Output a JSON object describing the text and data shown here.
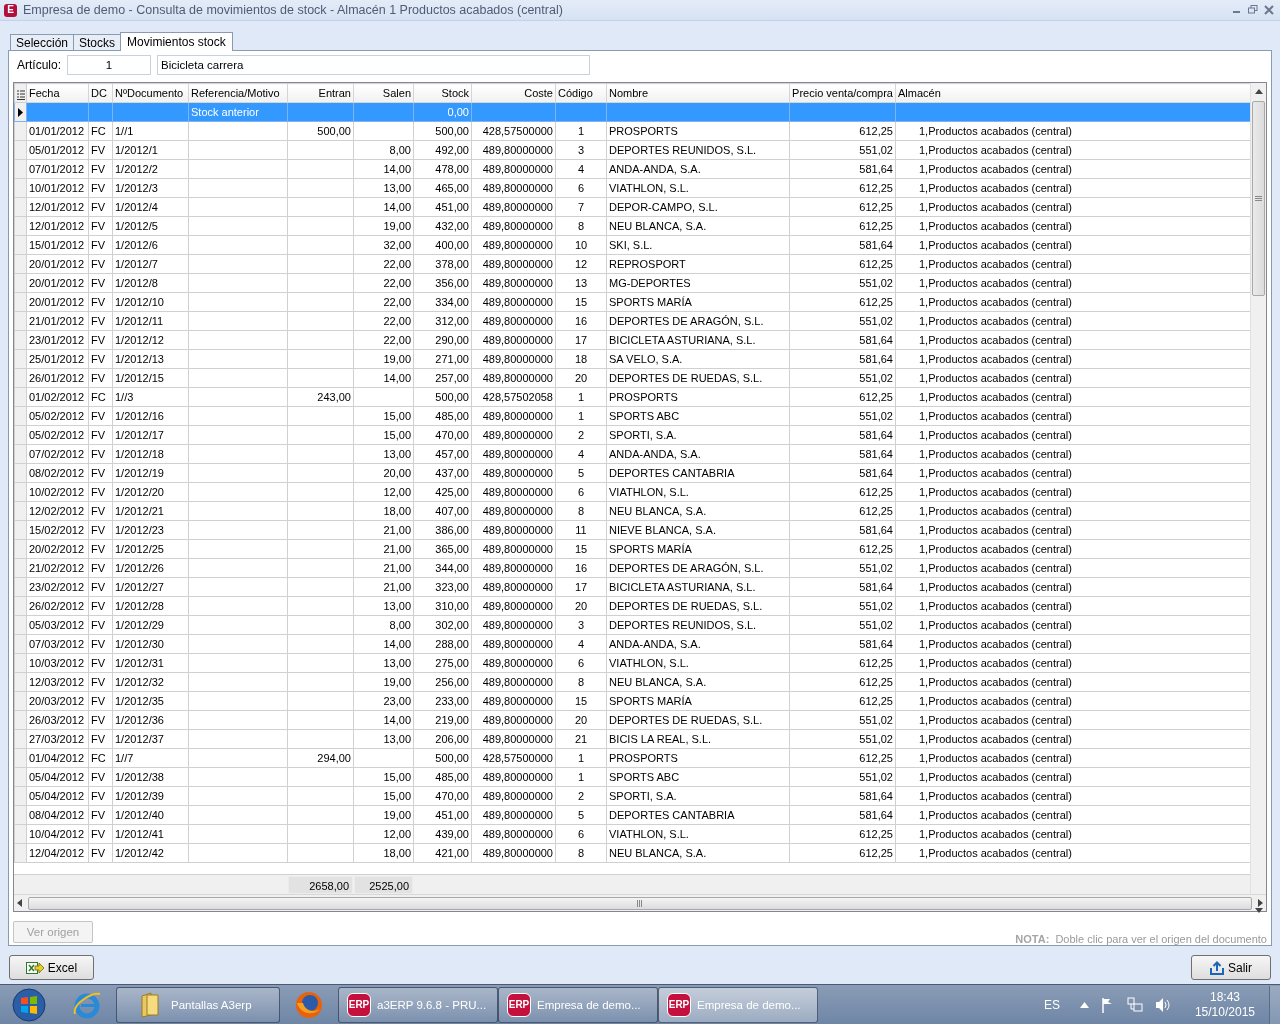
{
  "window": {
    "app_icon": "E",
    "title": "Empresa de demo - Consulta de movimientos de stock - Almacén 1 Productos acabados (central)"
  },
  "tabs": [
    {
      "label": "Selección",
      "selected": false
    },
    {
      "label": "Stocks",
      "selected": false
    },
    {
      "label": "Movimientos stock",
      "selected": true
    }
  ],
  "article": {
    "label": "Artículo:",
    "code": "1",
    "name": "Bicicleta carrera"
  },
  "grid": {
    "columns": [
      "Fecha",
      "DC",
      "NºDocumento",
      "Referencia/Motivo",
      "Entran",
      "Salen",
      "Stock",
      "Coste",
      "Código",
      "Nombre",
      "Precio venta/compra",
      "Almacén"
    ],
    "rows": [
      {
        "selected": true,
        "referencia": "Stock anterior",
        "stock": "0,00"
      },
      {
        "selected": false,
        "fecha": "01/01/2012",
        "dc": "FC",
        "documento": "1//1",
        "entran": "500,00",
        "stock": "500,00",
        "coste": "428,57500000",
        "codigo": "1",
        "nombre": "PROSPORTS",
        "precio": "612,25",
        "almacen": "1,Productos acabados (central)"
      },
      {
        "selected": false,
        "fecha": "05/01/2012",
        "dc": "FV",
        "documento": "1/2012/1",
        "salen": "8,00",
        "stock": "492,00",
        "coste": "489,80000000",
        "codigo": "3",
        "nombre": "DEPORTES REUNIDOS, S.L.",
        "precio": "551,02",
        "almacen": "1,Productos acabados (central)"
      },
      {
        "selected": false,
        "fecha": "07/01/2012",
        "dc": "FV",
        "documento": "1/2012/2",
        "salen": "14,00",
        "stock": "478,00",
        "coste": "489,80000000",
        "codigo": "4",
        "nombre": "ANDA-ANDA, S.A.",
        "precio": "581,64",
        "almacen": "1,Productos acabados (central)"
      },
      {
        "selected": false,
        "fecha": "10/01/2012",
        "dc": "FV",
        "documento": "1/2012/3",
        "salen": "13,00",
        "stock": "465,00",
        "coste": "489,80000000",
        "codigo": "6",
        "nombre": "VIATHLON, S.L.",
        "precio": "612,25",
        "almacen": "1,Productos acabados (central)"
      },
      {
        "selected": false,
        "fecha": "12/01/2012",
        "dc": "FV",
        "documento": "1/2012/4",
        "salen": "14,00",
        "stock": "451,00",
        "coste": "489,80000000",
        "codigo": "7",
        "nombre": "DEPOR-CAMPO, S.L.",
        "precio": "612,25",
        "almacen": "1,Productos acabados (central)"
      },
      {
        "selected": false,
        "fecha": "12/01/2012",
        "dc": "FV",
        "documento": "1/2012/5",
        "salen": "19,00",
        "stock": "432,00",
        "coste": "489,80000000",
        "codigo": "8",
        "nombre": "NEU BLANCA, S.A.",
        "precio": "612,25",
        "almacen": "1,Productos acabados (central)"
      },
      {
        "selected": false,
        "fecha": "15/01/2012",
        "dc": "FV",
        "documento": "1/2012/6",
        "salen": "32,00",
        "stock": "400,00",
        "coste": "489,80000000",
        "codigo": "10",
        "nombre": "SKI, S.L.",
        "precio": "581,64",
        "almacen": "1,Productos acabados (central)"
      },
      {
        "selected": false,
        "fecha": "20/01/2012",
        "dc": "FV",
        "documento": "1/2012/7",
        "salen": "22,00",
        "stock": "378,00",
        "coste": "489,80000000",
        "codigo": "12",
        "nombre": "REPROSPORT",
        "precio": "612,25",
        "almacen": "1,Productos acabados (central)"
      },
      {
        "selected": false,
        "fecha": "20/01/2012",
        "dc": "FV",
        "documento": "1/2012/8",
        "salen": "22,00",
        "stock": "356,00",
        "coste": "489,80000000",
        "codigo": "13",
        "nombre": "MG-DEPORTES",
        "precio": "551,02",
        "almacen": "1,Productos acabados (central)"
      },
      {
        "selected": false,
        "fecha": "20/01/2012",
        "dc": "FV",
        "documento": "1/2012/10",
        "salen": "22,00",
        "stock": "334,00",
        "coste": "489,80000000",
        "codigo": "15",
        "nombre": "SPORTS MARÍA",
        "precio": "612,25",
        "almacen": "1,Productos acabados (central)"
      },
      {
        "selected": false,
        "fecha": "21/01/2012",
        "dc": "FV",
        "documento": "1/2012/11",
        "salen": "22,00",
        "stock": "312,00",
        "coste": "489,80000000",
        "codigo": "16",
        "nombre": "DEPORTES DE ARAGÓN, S.L.",
        "precio": "551,02",
        "almacen": "1,Productos acabados (central)"
      },
      {
        "selected": false,
        "fecha": "23/01/2012",
        "dc": "FV",
        "documento": "1/2012/12",
        "salen": "22,00",
        "stock": "290,00",
        "coste": "489,80000000",
        "codigo": "17",
        "nombre": "BICICLETA ASTURIANA, S.L.",
        "precio": "581,64",
        "almacen": "1,Productos acabados (central)"
      },
      {
        "selected": false,
        "fecha": "25/01/2012",
        "dc": "FV",
        "documento": "1/2012/13",
        "salen": "19,00",
        "stock": "271,00",
        "coste": "489,80000000",
        "codigo": "18",
        "nombre": "SA VELO, S.A.",
        "precio": "581,64",
        "almacen": "1,Productos acabados (central)"
      },
      {
        "selected": false,
        "fecha": "26/01/2012",
        "dc": "FV",
        "documento": "1/2012/15",
        "salen": "14,00",
        "stock": "257,00",
        "coste": "489,80000000",
        "codigo": "20",
        "nombre": "DEPORTES DE RUEDAS, S.L.",
        "precio": "551,02",
        "almacen": "1,Productos acabados (central)"
      },
      {
        "selected": false,
        "fecha": "01/02/2012",
        "dc": "FC",
        "documento": "1//3",
        "entran": "243,00",
        "stock": "500,00",
        "coste": "428,57502058",
        "codigo": "1",
        "nombre": "PROSPORTS",
        "precio": "612,25",
        "almacen": "1,Productos acabados (central)"
      },
      {
        "selected": false,
        "fecha": "05/02/2012",
        "dc": "FV",
        "documento": "1/2012/16",
        "salen": "15,00",
        "stock": "485,00",
        "coste": "489,80000000",
        "codigo": "1",
        "nombre": "SPORTS ABC",
        "precio": "551,02",
        "almacen": "1,Productos acabados (central)"
      },
      {
        "selected": false,
        "fecha": "05/02/2012",
        "dc": "FV",
        "documento": "1/2012/17",
        "salen": "15,00",
        "stock": "470,00",
        "coste": "489,80000000",
        "codigo": "2",
        "nombre": "SPORTI, S.A.",
        "precio": "581,64",
        "almacen": "1,Productos acabados (central)"
      },
      {
        "selected": false,
        "fecha": "07/02/2012",
        "dc": "FV",
        "documento": "1/2012/18",
        "salen": "13,00",
        "stock": "457,00",
        "coste": "489,80000000",
        "codigo": "4",
        "nombre": "ANDA-ANDA, S.A.",
        "precio": "581,64",
        "almacen": "1,Productos acabados (central)"
      },
      {
        "selected": false,
        "fecha": "08/02/2012",
        "dc": "FV",
        "documento": "1/2012/19",
        "salen": "20,00",
        "stock": "437,00",
        "coste": "489,80000000",
        "codigo": "5",
        "nombre": "DEPORTES CANTABRIA",
        "precio": "581,64",
        "almacen": "1,Productos acabados (central)"
      },
      {
        "selected": false,
        "fecha": "10/02/2012",
        "dc": "FV",
        "documento": "1/2012/20",
        "salen": "12,00",
        "stock": "425,00",
        "coste": "489,80000000",
        "codigo": "6",
        "nombre": "VIATHLON, S.L.",
        "precio": "612,25",
        "almacen": "1,Productos acabados (central)"
      },
      {
        "selected": false,
        "fecha": "12/02/2012",
        "dc": "FV",
        "documento": "1/2012/21",
        "salen": "18,00",
        "stock": "407,00",
        "coste": "489,80000000",
        "codigo": "8",
        "nombre": "NEU BLANCA, S.A.",
        "precio": "612,25",
        "almacen": "1,Productos acabados (central)"
      },
      {
        "selected": false,
        "fecha": "15/02/2012",
        "dc": "FV",
        "documento": "1/2012/23",
        "salen": "21,00",
        "stock": "386,00",
        "coste": "489,80000000",
        "codigo": "11",
        "nombre": "NIEVE BLANCA, S.A.",
        "precio": "581,64",
        "almacen": "1,Productos acabados (central)"
      },
      {
        "selected": false,
        "fecha": "20/02/2012",
        "dc": "FV",
        "documento": "1/2012/25",
        "salen": "21,00",
        "stock": "365,00",
        "coste": "489,80000000",
        "codigo": "15",
        "nombre": "SPORTS MARÍA",
        "precio": "612,25",
        "almacen": "1,Productos acabados (central)"
      },
      {
        "selected": false,
        "fecha": "21/02/2012",
        "dc": "FV",
        "documento": "1/2012/26",
        "salen": "21,00",
        "stock": "344,00",
        "coste": "489,80000000",
        "codigo": "16",
        "nombre": "DEPORTES DE ARAGÓN, S.L.",
        "precio": "551,02",
        "almacen": "1,Productos acabados (central)"
      },
      {
        "selected": false,
        "fecha": "23/02/2012",
        "dc": "FV",
        "documento": "1/2012/27",
        "salen": "21,00",
        "stock": "323,00",
        "coste": "489,80000000",
        "codigo": "17",
        "nombre": "BICICLETA ASTURIANA, S.L.",
        "precio": "581,64",
        "almacen": "1,Productos acabados (central)"
      },
      {
        "selected": false,
        "fecha": "26/02/2012",
        "dc": "FV",
        "documento": "1/2012/28",
        "salen": "13,00",
        "stock": "310,00",
        "coste": "489,80000000",
        "codigo": "20",
        "nombre": "DEPORTES DE RUEDAS, S.L.",
        "precio": "551,02",
        "almacen": "1,Productos acabados (central)"
      },
      {
        "selected": false,
        "fecha": "05/03/2012",
        "dc": "FV",
        "documento": "1/2012/29",
        "salen": "8,00",
        "stock": "302,00",
        "coste": "489,80000000",
        "codigo": "3",
        "nombre": "DEPORTES REUNIDOS, S.L.",
        "precio": "551,02",
        "almacen": "1,Productos acabados (central)"
      },
      {
        "selected": false,
        "fecha": "07/03/2012",
        "dc": "FV",
        "documento": "1/2012/30",
        "salen": "14,00",
        "stock": "288,00",
        "coste": "489,80000000",
        "codigo": "4",
        "nombre": "ANDA-ANDA, S.A.",
        "precio": "581,64",
        "almacen": "1,Productos acabados (central)"
      },
      {
        "selected": false,
        "fecha": "10/03/2012",
        "dc": "FV",
        "documento": "1/2012/31",
        "salen": "13,00",
        "stock": "275,00",
        "coste": "489,80000000",
        "codigo": "6",
        "nombre": "VIATHLON, S.L.",
        "precio": "612,25",
        "almacen": "1,Productos acabados (central)"
      },
      {
        "selected": false,
        "fecha": "12/03/2012",
        "dc": "FV",
        "documento": "1/2012/32",
        "salen": "19,00",
        "stock": "256,00",
        "coste": "489,80000000",
        "codigo": "8",
        "nombre": "NEU BLANCA, S.A.",
        "precio": "612,25",
        "almacen": "1,Productos acabados (central)"
      },
      {
        "selected": false,
        "fecha": "20/03/2012",
        "dc": "FV",
        "documento": "1/2012/35",
        "salen": "23,00",
        "stock": "233,00",
        "coste": "489,80000000",
        "codigo": "15",
        "nombre": "SPORTS MARÍA",
        "precio": "612,25",
        "almacen": "1,Productos acabados (central)"
      },
      {
        "selected": false,
        "fecha": "26/03/2012",
        "dc": "FV",
        "documento": "1/2012/36",
        "salen": "14,00",
        "stock": "219,00",
        "coste": "489,80000000",
        "codigo": "20",
        "nombre": "DEPORTES DE RUEDAS, S.L.",
        "precio": "551,02",
        "almacen": "1,Productos acabados (central)"
      },
      {
        "selected": false,
        "fecha": "27/03/2012",
        "dc": "FV",
        "documento": "1/2012/37",
        "salen": "13,00",
        "stock": "206,00",
        "coste": "489,80000000",
        "codigo": "21",
        "nombre": "BICIS LA REAL, S.L.",
        "precio": "551,02",
        "almacen": "1,Productos acabados (central)"
      },
      {
        "selected": false,
        "fecha": "01/04/2012",
        "dc": "FC",
        "documento": "1//7",
        "entran": "294,00",
        "stock": "500,00",
        "coste": "428,57500000",
        "codigo": "1",
        "nombre": "PROSPORTS",
        "precio": "612,25",
        "almacen": "1,Productos acabados (central)"
      },
      {
        "selected": false,
        "fecha": "05/04/2012",
        "dc": "FV",
        "documento": "1/2012/38",
        "salen": "15,00",
        "stock": "485,00",
        "coste": "489,80000000",
        "codigo": "1",
        "nombre": "SPORTS ABC",
        "precio": "551,02",
        "almacen": "1,Productos acabados (central)"
      },
      {
        "selected": false,
        "fecha": "05/04/2012",
        "dc": "FV",
        "documento": "1/2012/39",
        "salen": "15,00",
        "stock": "470,00",
        "coste": "489,80000000",
        "codigo": "2",
        "nombre": "SPORTI, S.A.",
        "precio": "581,64",
        "almacen": "1,Productos acabados (central)"
      },
      {
        "selected": false,
        "fecha": "08/04/2012",
        "dc": "FV",
        "documento": "1/2012/40",
        "salen": "19,00",
        "stock": "451,00",
        "coste": "489,80000000",
        "codigo": "5",
        "nombre": "DEPORTES CANTABRIA",
        "precio": "581,64",
        "almacen": "1,Productos acabados (central)"
      },
      {
        "selected": false,
        "fecha": "10/04/2012",
        "dc": "FV",
        "documento": "1/2012/41",
        "salen": "12,00",
        "stock": "439,00",
        "coste": "489,80000000",
        "codigo": "6",
        "nombre": "VIATHLON, S.L.",
        "precio": "612,25",
        "almacen": "1,Productos acabados (central)"
      },
      {
        "selected": false,
        "fecha": "12/04/2012",
        "dc": "FV",
        "documento": "1/2012/42",
        "salen": "18,00",
        "stock": "421,00",
        "coste": "489,80000000",
        "codigo": "8",
        "nombre": "NEU BLANCA, S.A.",
        "precio": "612,25",
        "almacen": "1,Productos acabados (central)"
      }
    ],
    "totals": {
      "entran": "2658,00",
      "salen": "2525,00"
    }
  },
  "origin_button": {
    "label": "Ver origen",
    "disabled": true
  },
  "note": {
    "label": "NOTA:",
    "text": "Doble clic para ver el origen del documento"
  },
  "footer_buttons": [
    {
      "kind": "export",
      "label": "Excel"
    },
    {
      "kind": "exit",
      "label": "Salir"
    }
  ],
  "taskbar": {
    "items": [
      {
        "kind": "start"
      },
      {
        "kind": "ie"
      },
      {
        "kind": "folder",
        "label": "Pantallas A3erp",
        "active": false
      },
      {
        "kind": "firefox"
      },
      {
        "kind": "erp",
        "badge": "ERP",
        "label": "a3ERP 9.6.8 - PRU...",
        "active": false
      },
      {
        "kind": "erp",
        "badge": "ERP",
        "label": "Empresa de demo...",
        "active": false
      },
      {
        "kind": "erp",
        "badge": "ERP",
        "label": "Empresa de demo...",
        "active": true
      }
    ],
    "language": "ES",
    "time": "18:43",
    "date": "15/10/2015"
  }
}
